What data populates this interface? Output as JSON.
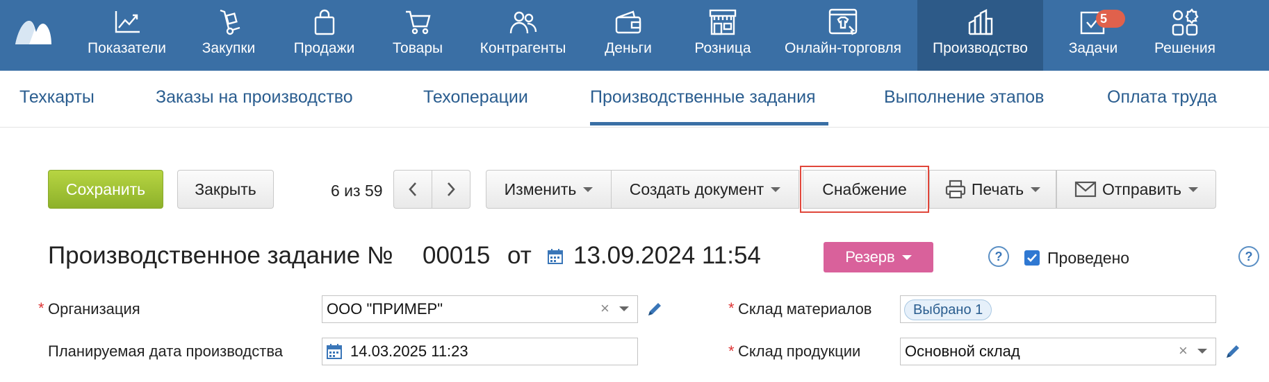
{
  "topnav": {
    "items": [
      {
        "label": "Показатели",
        "icon": "chart-line-icon"
      },
      {
        "label": "Закупки",
        "icon": "hand-truck-icon"
      },
      {
        "label": "Продажи",
        "icon": "shopping-bag-icon"
      },
      {
        "label": "Товары",
        "icon": "cart-icon"
      },
      {
        "label": "Контрагенты",
        "icon": "users-icon"
      },
      {
        "label": "Деньги",
        "icon": "wallet-icon"
      },
      {
        "label": "Розница",
        "icon": "store-icon"
      },
      {
        "label": "Онлайн-торговля",
        "icon": "online-shop-icon"
      },
      {
        "label": "Производство",
        "icon": "factory-icon"
      },
      {
        "label": "Задачи",
        "icon": "tasks-icon"
      },
      {
        "label": "Решения",
        "icon": "apps-icon"
      }
    ],
    "active": "Производство",
    "tasks_badge": "5",
    "colors": {
      "bar": "#3a6fa5",
      "active": "#2d5a88",
      "badge": "#e0614c"
    }
  },
  "subnav": {
    "tabs": [
      "Техкарты",
      "Заказы на производство",
      "Техоперации",
      "Производственные задания",
      "Выполнение этапов",
      "Оплата труда"
    ],
    "active": "Производственные задания"
  },
  "toolbar": {
    "save_label": "Сохранить",
    "close_label": "Закрыть",
    "pager": "6 из 59",
    "change_label": "Изменить",
    "create_doc_label": "Создать документ",
    "supply_label": "Снабжение",
    "print_label": "Печать",
    "send_label": "Отправить"
  },
  "header": {
    "title": "Производственное задание №",
    "number": "00015",
    "ot": "от",
    "date": "13.09.2024 11:54",
    "status": "Резерв",
    "posted_label": "Проведено",
    "posted": true,
    "help": "?"
  },
  "form": {
    "org_label": "Организация",
    "org_value": "ООО \"ПРИМЕР\"",
    "planned_date_label": "Планируемая дата производства",
    "planned_date_value": "14.03.2025 11:23",
    "materials_wh_label": "Склад материалов",
    "materials_wh_tag": "Выбрано 1",
    "products_wh_label": "Склад продукции",
    "products_wh_value": "Основной склад",
    "required_mark": "*"
  }
}
